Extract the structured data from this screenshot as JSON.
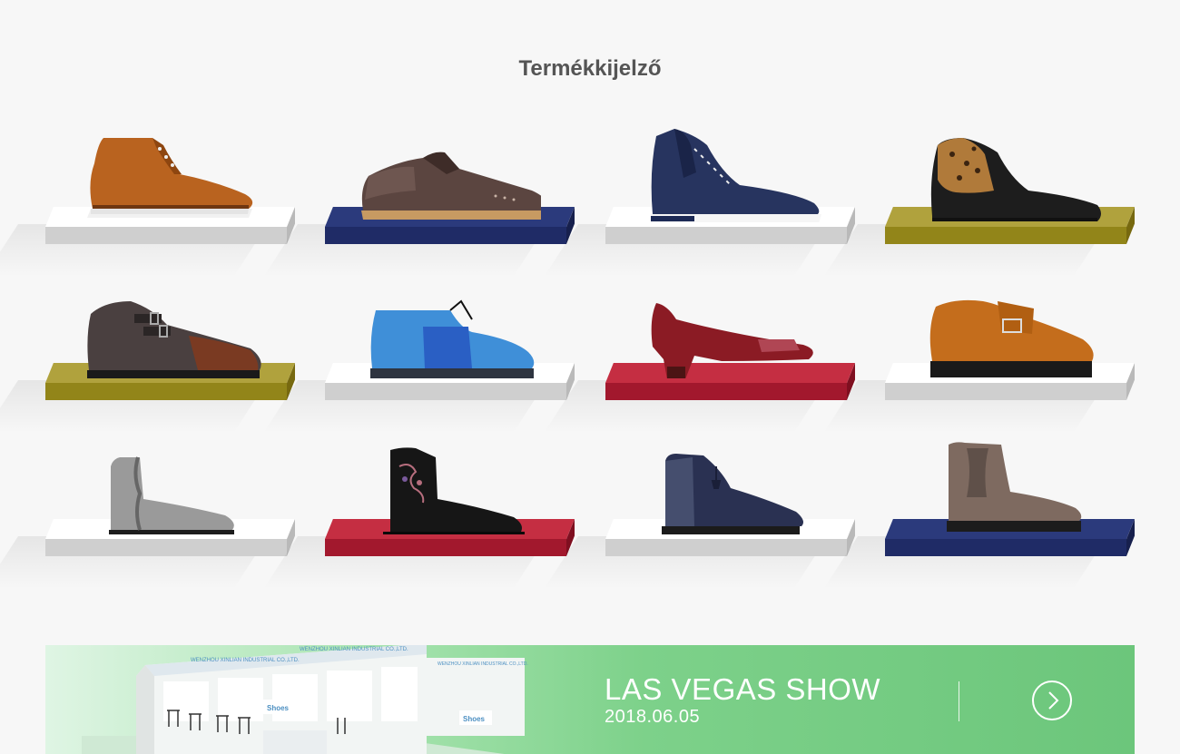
{
  "section_title": "Termékkijelző",
  "products": [
    {
      "shelf": "white",
      "shoe": "tan-chukka-boot-icon"
    },
    {
      "shelf": "navy",
      "shoe": "brown-brogue-derby-icon"
    },
    {
      "shelf": "white",
      "shoe": "navy-high-top-sneaker-icon"
    },
    {
      "shelf": "olive",
      "shoe": "leopard-high-top-sneaker-icon"
    },
    {
      "shelf": "olive",
      "shoe": "burnished-monk-strap-shoe-icon"
    },
    {
      "shelf": "white",
      "shoe": "blue-derby-shoe-icon"
    },
    {
      "shelf": "red",
      "shoe": "burgundy-block-heel-pump-icon"
    },
    {
      "shelf": "white",
      "shoe": "tan-fringe-loafer-icon"
    },
    {
      "shelf": "white",
      "shoe": "silver-ruffle-ankle-boot-icon"
    },
    {
      "shelf": "red",
      "shoe": "black-embroidered-ankle-boot-icon"
    },
    {
      "shelf": "white",
      "shoe": "navy-tassel-chelsea-boot-icon"
    },
    {
      "shelf": "navy",
      "shoe": "taupe-chelsea-boot-icon"
    }
  ],
  "shelf_colors": {
    "white": {
      "top": "#ffffff",
      "front": "#cfcfcf",
      "side": "#b9b9b9"
    },
    "navy": {
      "top": "#2b3a7c",
      "front": "#1f2b66",
      "side": "#17204d"
    },
    "olive": {
      "top": "#b0a23d",
      "front": "#928519",
      "side": "#77690f"
    },
    "red": {
      "top": "#c52e42",
      "front": "#a2182d",
      "side": "#7f0f20"
    }
  },
  "banner": {
    "booth_sign_main": "WENZHOU XINLIAN INDUSTRIAL CO.,LTD.",
    "booth_sign_left": "WENZHOU XINLIAN INDUSTRIAL CO.,LTD.",
    "booth_sign_right": "WENZHOU XINLIAN INDUSTRIAL CO.,LTD.",
    "booth_logo": "Shoes",
    "title": "LAS VEGAS SHOW",
    "date": "2018.06.05",
    "next_icon": "chevron-right-icon"
  }
}
